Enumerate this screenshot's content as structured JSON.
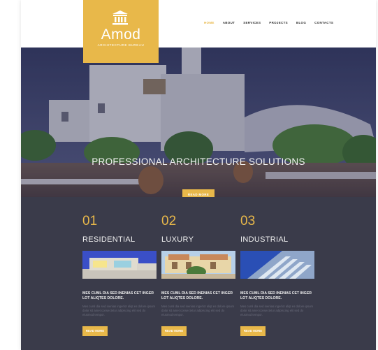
{
  "brand": {
    "name": "Amod",
    "tagline": "ARCHITECTURE BUREAU",
    "accent": "#e8b84a"
  },
  "nav": {
    "items": [
      "HOME",
      "ABOUT",
      "SERVICES",
      "PROJECTS",
      "BLOG",
      "CONTACTS"
    ],
    "active": "HOME"
  },
  "hero": {
    "title": "PROFESSIONAL ARCHITECTURE SOLUTIONS",
    "button": "READ MORE"
  },
  "services": [
    {
      "num": "01",
      "title": "RESIDENTIAL",
      "heading": "MES CUML DIA SED INENIAS CET INGER LOT ALIQTES DOLORE.",
      "desc": "Mes cuml dia sed inenias ingerlot aliqt es dolore ipsum dolor sit amet consectetur adipiscing elit sed do eiusmod tempor.",
      "button": "READ MORE"
    },
    {
      "num": "02",
      "title": "LUXURY",
      "heading": "MES CUML DIA SED INENIAS CET INGER LOT ALIQTES DOLORE.",
      "desc": "Mes cuml dia sed inenias ingerlot aliqt es dolore ipsum dolor sit amet consectetur adipiscing elit sed do eiusmod tempor.",
      "button": "READ MORE"
    },
    {
      "num": "03",
      "title": "INDUSTRIAL",
      "heading": "MES CUML DIA SED INENIAS CET INGER LOT ALIQTES DOLORE.",
      "desc": "Mes cuml dia sed inenias ingerlot aliqt es dolore ipsum dolor sit amet consectetur adipiscing elit sed do eiusmod tempor.",
      "button": "READ MORE"
    }
  ]
}
